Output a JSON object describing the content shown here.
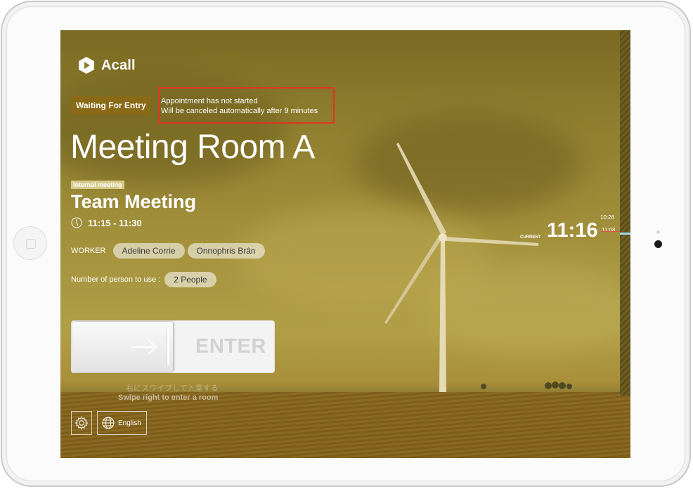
{
  "app": {
    "brand": "Acall"
  },
  "status": {
    "badge": "Waiting For Entry"
  },
  "notice": {
    "line1": "Appointment has not started",
    "line2": "Will be canceled automatically after 9 minutes"
  },
  "room": {
    "name": "Meeting Room A"
  },
  "meeting": {
    "type_tag": "Internal meeting",
    "title": "Team Meeting",
    "time": "11:15 - 11:30",
    "worker_label": "WORKER",
    "workers": [
      "Adeline Corrie",
      "Onnophris Brân"
    ],
    "persons_label": "Number of person to use :",
    "persons_value": "2 People"
  },
  "swipe": {
    "label": "ENTER",
    "hint_jp": "右にスワイプして入室する",
    "hint_en": "Swipe right to enter a room"
  },
  "footer": {
    "language": "English"
  },
  "timeline": {
    "current_label": "CURRENT",
    "current_time": "11:16",
    "tick_top": "10:26",
    "tick_marker": "11:08"
  },
  "colors": {
    "badge": "#8a6a16",
    "notice_border": "#e1351f",
    "overlay": "#9a883a"
  },
  "icons": {
    "logo": "acall-logo-icon",
    "clock": "clock-icon",
    "arrow": "arrow-right-icon",
    "settings": "gear-icon",
    "language": "globe-icon"
  }
}
